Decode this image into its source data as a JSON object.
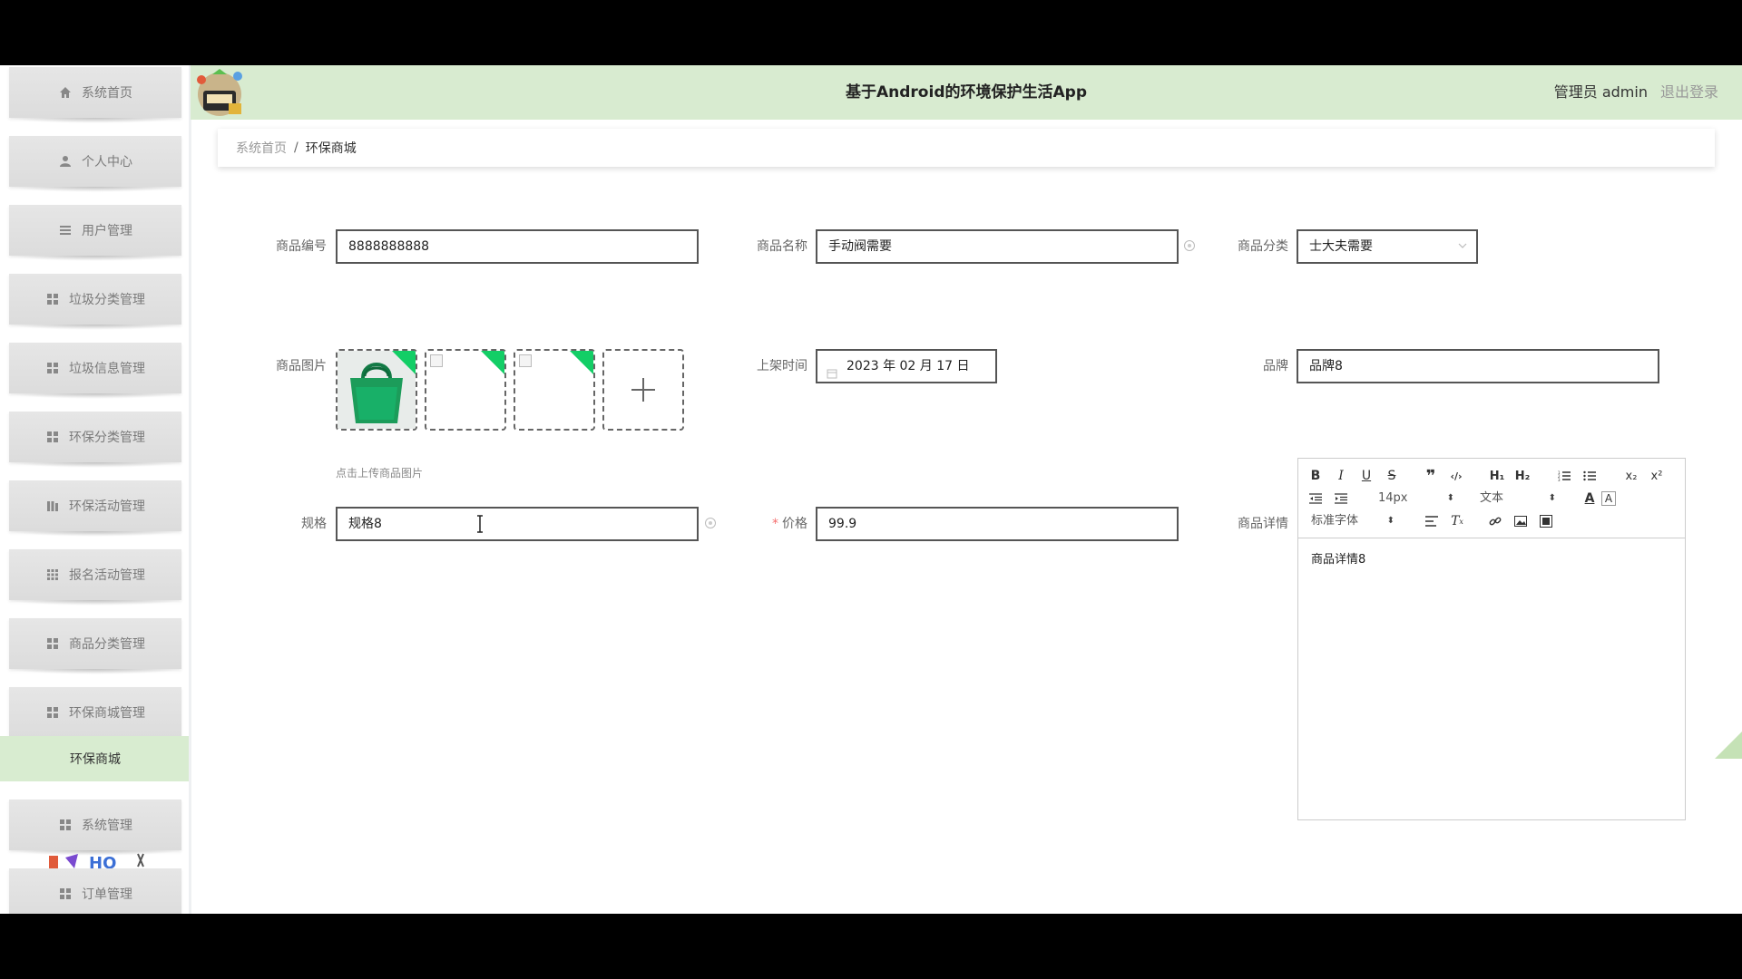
{
  "app": {
    "title": "基于Android的环境保护生活App",
    "user_label": "管理员 admin",
    "logout_label": "退出登录"
  },
  "sidebar": {
    "items": [
      {
        "label": "系统首页",
        "icon": "home-icon"
      },
      {
        "label": "个人中心",
        "icon": "user-icon"
      },
      {
        "label": "用户管理",
        "icon": "menu-icon"
      },
      {
        "label": "垃圾分类管理",
        "icon": "grid-icon"
      },
      {
        "label": "垃圾信息管理",
        "icon": "grid-icon"
      },
      {
        "label": "环保分类管理",
        "icon": "grid-icon"
      },
      {
        "label": "环保活动管理",
        "icon": "chart-icon"
      },
      {
        "label": "报名活动管理",
        "icon": "grid-icon"
      },
      {
        "label": "商品分类管理",
        "icon": "grid-icon"
      },
      {
        "label": "环保商城管理",
        "icon": "grid-icon"
      },
      {
        "label": "系统管理",
        "icon": "grid-icon"
      },
      {
        "label": "订单管理",
        "icon": "grid-icon"
      }
    ],
    "active_sub": "环保商城"
  },
  "breadcrumb": {
    "home": "系统首页",
    "separator": "/",
    "current": "环保商城"
  },
  "form": {
    "product_code": {
      "label": "商品编号",
      "value": "8888888888"
    },
    "product_name": {
      "label": "商品名称",
      "value": "手动阀需要"
    },
    "category": {
      "label": "商品分类",
      "value": "士大夫需要"
    },
    "images": {
      "label": "商品图片",
      "hint": "点击上传商品图片"
    },
    "listing_time": {
      "label": "上架时间",
      "value": "2023 年 02 月 17 日"
    },
    "brand": {
      "label": "品牌",
      "value": "品牌8"
    },
    "spec": {
      "label": "规格",
      "value": "规格8"
    },
    "price": {
      "label": "价格",
      "required_mark": "*",
      "value": "99.9"
    },
    "detail": {
      "label": "商品详情",
      "content": "商品详情8"
    }
  },
  "editor": {
    "font_size": "14px",
    "text_style": "文本",
    "font_family": "标准字体"
  },
  "colors": {
    "header_bg": "#d8ebd0",
    "active_sub_bg": "#d8ecd0",
    "upload_corner": "#13ce66",
    "required": "#f56c6c"
  }
}
